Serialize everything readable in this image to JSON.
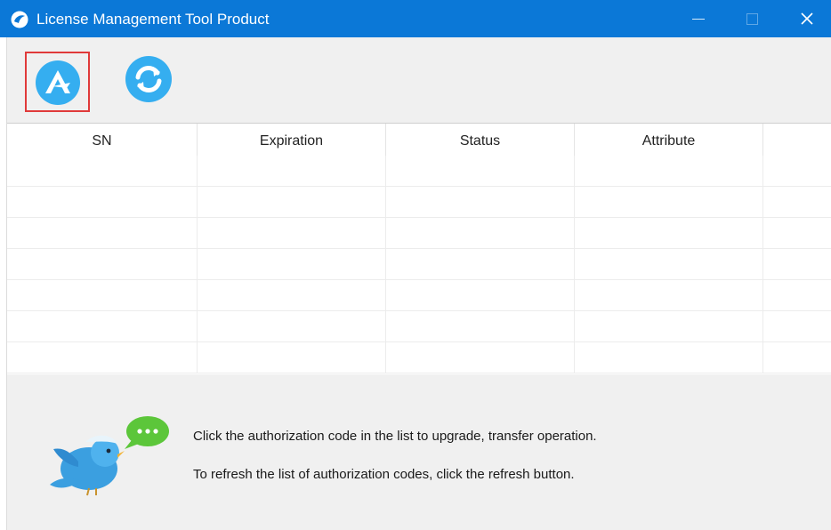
{
  "window": {
    "title": "License Management Tool Product",
    "titlebar_color": "#0b78d7",
    "controls": [
      "minimize-icon",
      "maximize-icon",
      "close-icon"
    ]
  },
  "toolbar": {
    "buttons": [
      {
        "id": "upgrade",
        "icon": "authorize-icon",
        "selected": true,
        "highlight_color": "#e03a3a"
      },
      {
        "id": "refresh",
        "icon": "refresh-icon"
      }
    ],
    "icon_color": "#35aef0"
  },
  "table": {
    "columns": [
      "SN",
      "Expiration",
      "Status",
      "Attribute",
      ""
    ],
    "rows": []
  },
  "info": {
    "icon": "bird-chat-icon",
    "lines": [
      "Click the authorization code in the list to upgrade, transfer operation.",
      "To refresh the list of authorization codes, click the refresh button."
    ]
  }
}
